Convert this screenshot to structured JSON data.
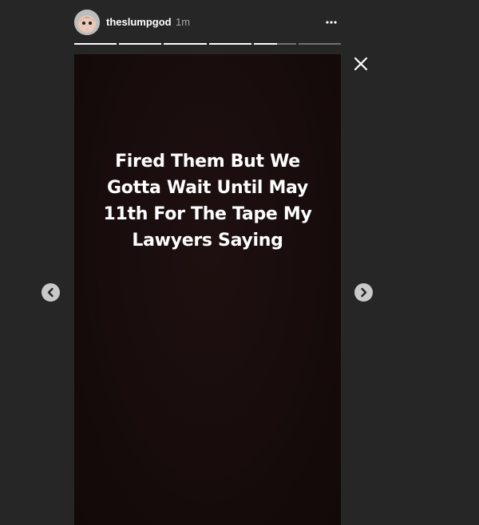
{
  "header": {
    "username": "theslumpgod",
    "time": "1m",
    "avatar_icon": "profile-avatar-icon",
    "more_icon": "more-dots-icon"
  },
  "progress": {
    "segments": [
      1,
      1,
      1,
      1,
      0.55,
      0
    ]
  },
  "story": {
    "text": "Fired Them But We Gotta Wait Until May 11th For The Tape My Lawyers Saying"
  },
  "controls": {
    "close_icon": "close-icon",
    "prev_icon": "chevron-left-icon",
    "next_icon": "chevron-right-icon"
  },
  "colors": {
    "background": "#262626",
    "story_background": "#180c0c",
    "text": "#ffffff",
    "muted": "#a8a8a8",
    "nav_button": "#c9c9c9"
  }
}
